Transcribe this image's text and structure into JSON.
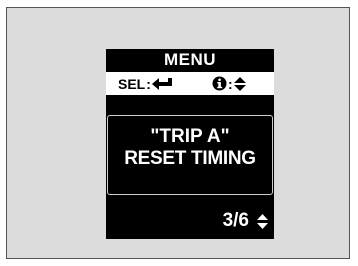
{
  "menu": {
    "title": "MENU"
  },
  "hints": {
    "select_label": "SEL",
    "select_icon": "enter-arrow-icon",
    "info_icon": "info-icon",
    "scroll_icon": "up-down-arrows-icon",
    "separator": ":"
  },
  "item": {
    "line1": "\"TRIP A\"",
    "line2": "RESET TIMING"
  },
  "pagination": {
    "current": "3/6",
    "icon": "up-down-arrows-icon"
  },
  "colors": {
    "screen_background": "#000000",
    "frame_background": "#dcdcdc",
    "text": "#ffffff",
    "hint_bar": "#ffffff"
  }
}
